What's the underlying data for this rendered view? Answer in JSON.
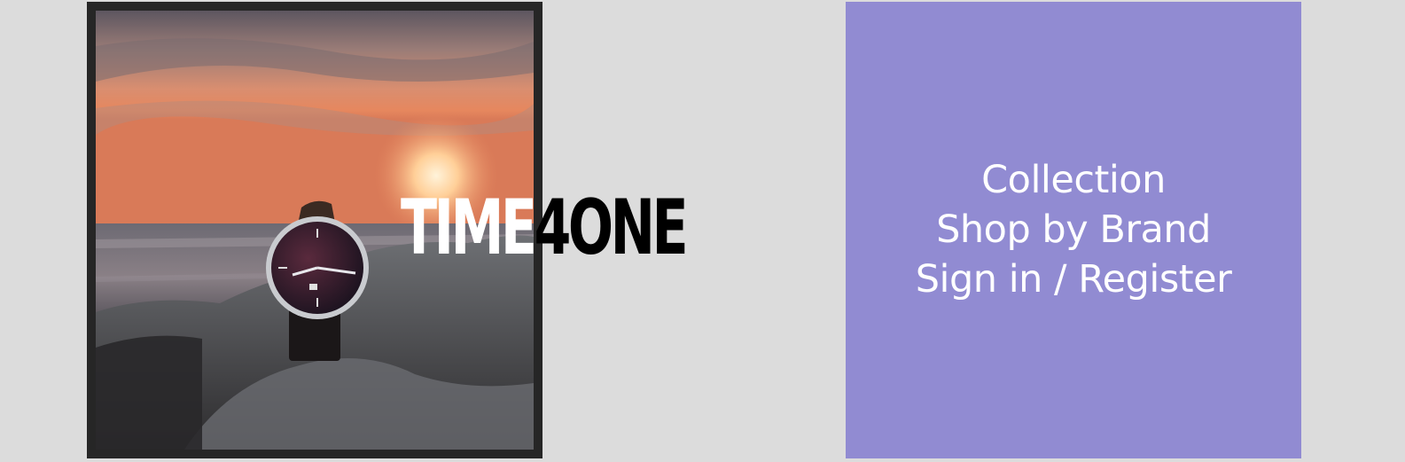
{
  "brand": {
    "part_a": "TIME",
    "part_b": "4ONE"
  },
  "hero_image": {
    "alt": "wristwatch-on-rock-at-sunset"
  },
  "menu": {
    "items": [
      {
        "label": "Collection"
      },
      {
        "label": "Shop by Brand"
      },
      {
        "label": "Sign in / Register"
      }
    ]
  },
  "colors": {
    "page_background": "#dcdcdc",
    "frame": "#262626",
    "menu_panel": "#918bd2",
    "menu_text": "#ffffff"
  }
}
